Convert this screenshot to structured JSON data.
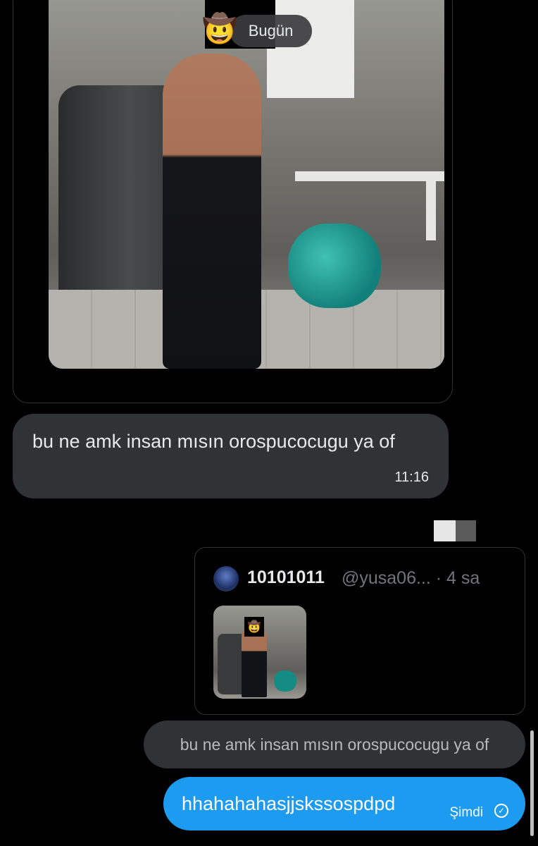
{
  "date_divider": "Bugün",
  "messages": {
    "received": {
      "text": "bu ne amk insan mısın orospucocugu ya of",
      "time": "11:16"
    },
    "quote": {
      "name": "10101011",
      "handle": "@yusa06... · 4 sa"
    },
    "reply_preview": "bu ne amk insan mısın orospucocugu ya of",
    "sent": {
      "text": "hhahahahasjjskssospdpd",
      "time": "Şimdi"
    }
  },
  "colors": {
    "background": "#000000",
    "bubble_gray": "#2f3336",
    "bubble_blue": "#1d9bf0",
    "muted_text": "#71767b"
  },
  "icons": {
    "censor_emoji": "cowboy-face-emoji",
    "sent_status": "check-circle-icon"
  }
}
